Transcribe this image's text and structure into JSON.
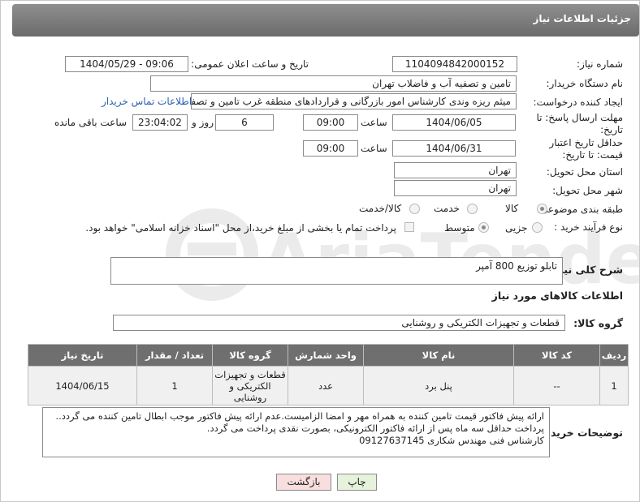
{
  "header": {
    "title": "جزئیات اطلاعات نیاز"
  },
  "need_number": {
    "label": "شماره نیاز:",
    "value": "1104094842000152"
  },
  "announce": {
    "label": "تاریخ و ساعت اعلان عمومی:",
    "value": "1404/05/29 - 09:06"
  },
  "buyer_org": {
    "label": "نام دستگاه خریدار:",
    "value": "تامین و تصفیه آب و فاضلاب تهران"
  },
  "requester": {
    "label": "ایجاد کننده درخواست:",
    "value": "میثم ریزه وندی کارشناس امور بازرگانی و قراردادهای منطقه غرب تامین و تصفیه",
    "contact_link": "اطلاعات تماس خریدار"
  },
  "deadline": {
    "label": "مهلت ارسال پاسخ: تا تاریخ:",
    "date": "1404/06/05",
    "time_label": "ساعت",
    "time": "09:00",
    "days": "6",
    "days_label": "روز و",
    "remaining": "23:04:02",
    "remaining_label": "ساعت باقی مانده"
  },
  "validity": {
    "label": "حداقل تاریخ اعتبار قیمت: تا تاریخ:",
    "date": "1404/06/31",
    "time_label": "ساعت",
    "time": "09:00"
  },
  "province": {
    "label": "استان محل تحویل:",
    "value": "تهران"
  },
  "city": {
    "label": "شهر محل تحویل:",
    "value": "تهران"
  },
  "category": {
    "label": "طبقه بندی موضوعی:",
    "options": [
      "کالا",
      "خدمت",
      "کالا/خدمت"
    ],
    "selected": "کالا"
  },
  "process": {
    "label": "نوع فرآیند خرید :",
    "options": [
      "جزیی",
      "متوسط"
    ],
    "selected": "متوسط",
    "note": "پرداخت تمام یا بخشی از مبلغ خرید،از محل \"اسناد خزانه اسلامی\" خواهد بود."
  },
  "description": {
    "label": "شرح کلی نیاز:",
    "value": "تابلو توزیع 800 آمپر"
  },
  "goods_info": {
    "label": "اطلاعات کالاهای مورد نیاز"
  },
  "goods_group": {
    "label": "گروه کالا:",
    "value": "قطعات و تجهیزات الکتریکی و روشنایی"
  },
  "table": {
    "headers": [
      "ردیف",
      "کد کالا",
      "نام کالا",
      "واحد شمارش",
      "گروه کالا",
      "تعداد / مقدار",
      "تاریخ نیاز"
    ],
    "rows": [
      [
        "1",
        "--",
        "پنل برد",
        "عدد",
        "قطعات و تجهیزات الکتریکی و روشنایی",
        "1",
        "1404/06/15"
      ]
    ]
  },
  "buyer_notes": {
    "label": "توضیحات خریدار:",
    "lines": [
      "ارائه پیش فاکتور قیمت تامین کننده به همراه مهر و امضا الزامیست.عدم ارائه پیش فاکتور موجب ابطال تامین کننده می گردد..",
      "پرداخت حداقل سه ماه پس از ارائه فاکتور الکترونیکی، بصورت نقدی پرداخت می گردد.",
      "کارشناس فنی مهندس شکاری 09127637145"
    ]
  },
  "buttons": {
    "print": "چاپ",
    "back": "بازگشت"
  },
  "colors": {
    "header": "#7a7a7a",
    "link": "#2a5db0",
    "print_bg": "#e6f2dc",
    "back_bg": "#f8dede"
  }
}
